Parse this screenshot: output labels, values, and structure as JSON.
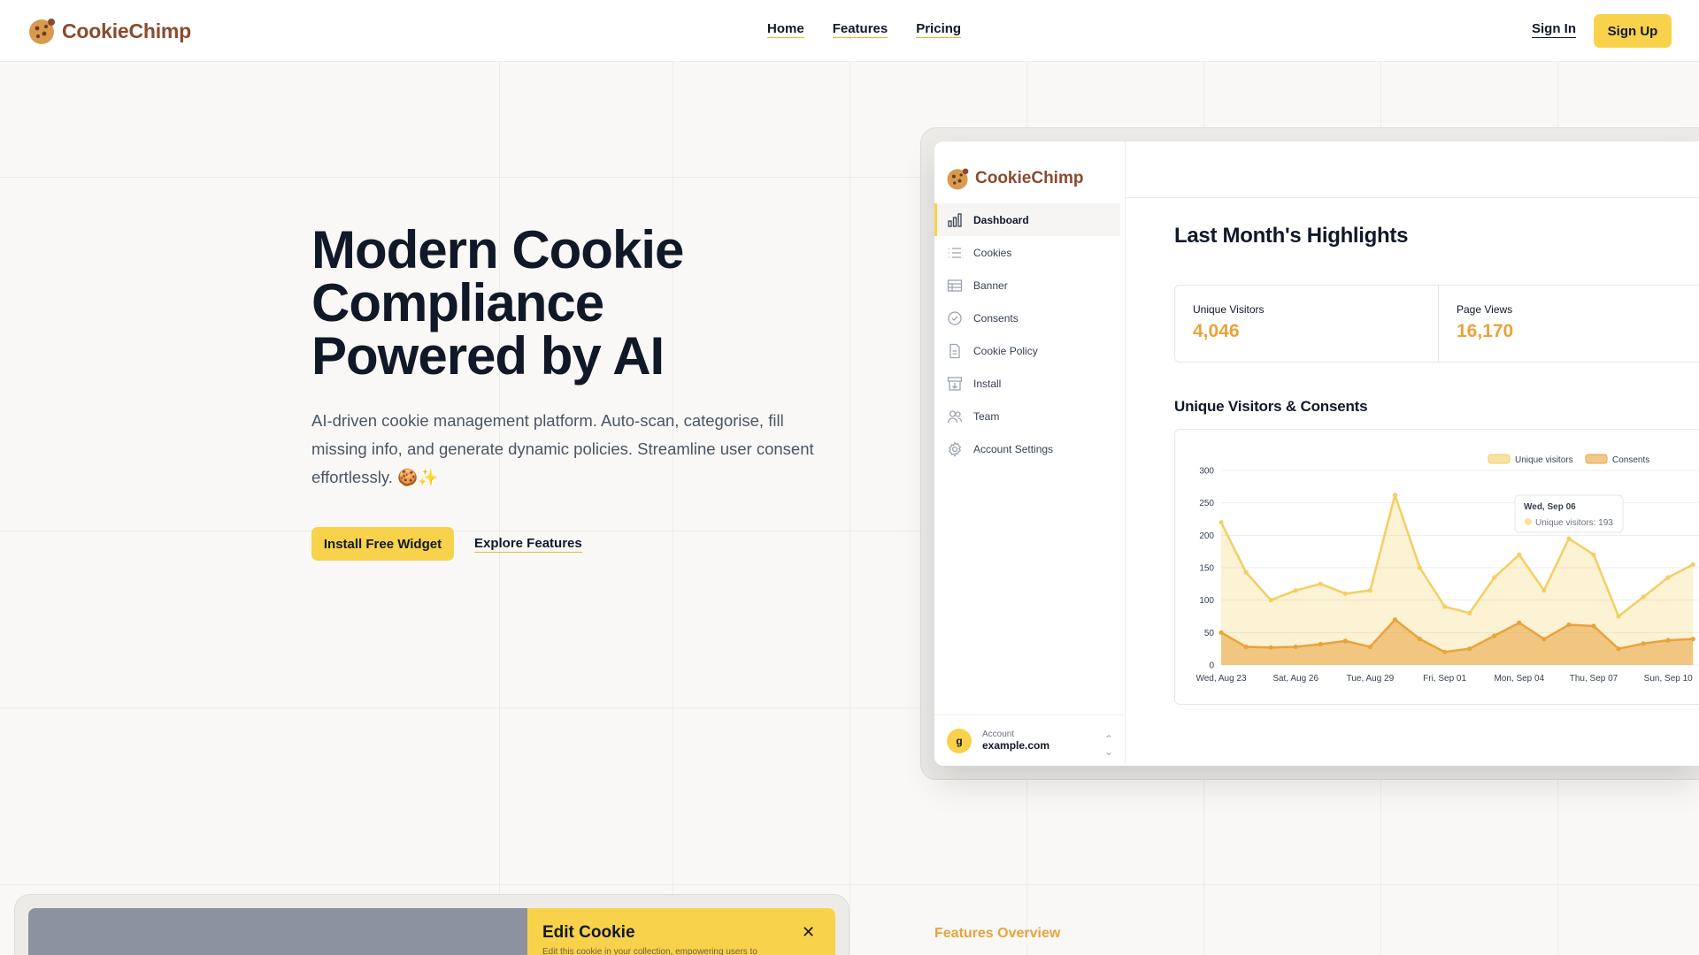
{
  "brand": {
    "name": "CookieChimp",
    "color": "#8a4b2c"
  },
  "nav": {
    "items": [
      "Home",
      "Features",
      "Pricing"
    ],
    "sign_in": "Sign In",
    "sign_up": "Sign Up"
  },
  "hero": {
    "title_lines": [
      "Modern Cookie",
      "Compliance",
      "Powered by AI"
    ],
    "subtitle": "AI-driven cookie management platform. Auto-scan, categorise, fill missing info, and generate dynamic policies. Streamline user consent effortlessly. 🍪✨",
    "primary_cta": "Install Free Widget",
    "secondary_cta": "Explore Features"
  },
  "app": {
    "logo": "CookieChimp",
    "sidebar": [
      {
        "label": "Dashboard",
        "icon": "bar-chart-icon",
        "active": true
      },
      {
        "label": "Cookies",
        "icon": "list-icon"
      },
      {
        "label": "Banner",
        "icon": "table-icon"
      },
      {
        "label": "Consents",
        "icon": "check-circle-icon"
      },
      {
        "label": "Cookie Policy",
        "icon": "file-icon"
      },
      {
        "label": "Install",
        "icon": "archive-download-icon"
      },
      {
        "label": "Team",
        "icon": "users-icon"
      },
      {
        "label": "Account Settings",
        "icon": "gear-icon"
      }
    ],
    "account": {
      "avatar": "g",
      "label": "Account",
      "value": "example.com"
    },
    "highlights_title": "Last Month's Highlights",
    "stats": [
      {
        "label": "Unique Visitors",
        "value": "4,046"
      },
      {
        "label": "Page Views",
        "value": "16,170"
      }
    ],
    "chart_title": "Unique Visitors & Consents",
    "tooltip": {
      "date": "Wed, Sep 06",
      "text": "Unique visitors: 193"
    }
  },
  "bottom": {
    "edit_title": "Edit Cookie",
    "edit_sub": "Edit this cookie in your collection, empowering users to",
    "close_icon": "close-icon",
    "features_overview": "Features Overview"
  },
  "colors": {
    "accent": "#f9d24b",
    "orange": "#e8a33c",
    "text": "#111827"
  },
  "chart_data": {
    "type": "area",
    "title": "",
    "x_ticks": [
      "Wed, Aug 23",
      "Sat, Aug 26",
      "Tue, Aug 29",
      "Fri, Sep 01",
      "Mon, Sep 04",
      "Thu, Sep 07",
      "Sun, Sep 10"
    ],
    "ylim": [
      0,
      300
    ],
    "y_ticks": [
      0,
      50,
      100,
      150,
      200,
      250,
      300
    ],
    "legend_position": "top-right",
    "series": [
      {
        "name": "Unique visitors",
        "color": "#f3cf63",
        "values": [
          220,
          143,
          100,
          115,
          125,
          110,
          115,
          262,
          150,
          90,
          80,
          135,
          170,
          115,
          195,
          170,
          75,
          105,
          135,
          155
        ]
      },
      {
        "name": "Consents",
        "color": "#e8a33c",
        "values": [
          50,
          28,
          27,
          28,
          32,
          37,
          28,
          70,
          40,
          20,
          25,
          45,
          65,
          40,
          62,
          60,
          25,
          33,
          38,
          40
        ]
      }
    ]
  }
}
